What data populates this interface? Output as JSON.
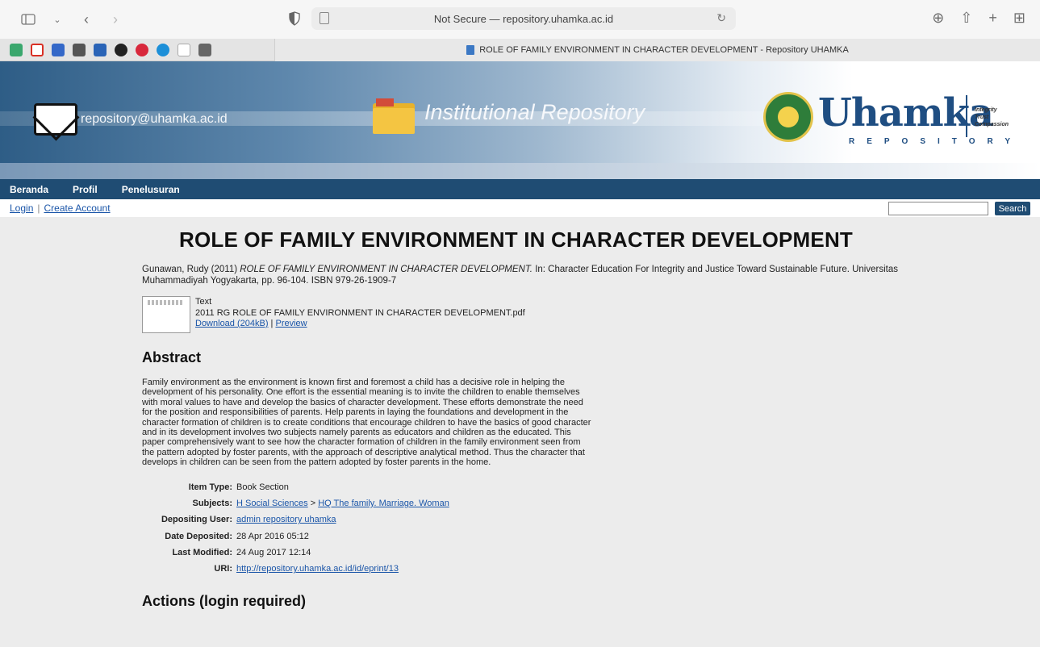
{
  "browser": {
    "address": "Not Secure — repository.uhamka.ac.id",
    "tab_title": "ROLE OF FAMILY ENVIRONMENT IN CHARACTER DEVELOPMENT - Repository UHAMKA"
  },
  "header": {
    "email": "repository@uhamka.ac.id",
    "repo_title": "Institutional Repository",
    "brand": "Uhamka",
    "brand_sub": "REPOSITORY",
    "tagline": [
      "Integrity",
      "Trust",
      "Compassion"
    ]
  },
  "nav": [
    "Beranda",
    "Profil",
    "Penelusuran"
  ],
  "account": {
    "login": "Login",
    "separator": "|",
    "create": "Create Account",
    "search_button": "Search"
  },
  "item": {
    "title": "ROLE OF FAMILY ENVIRONMENT IN CHARACTER DEVELOPMENT",
    "citation_prefix": "Gunawan, Rudy (2011) ",
    "citation_title": "ROLE OF FAMILY ENVIRONMENT IN CHARACTER DEVELOPMENT.",
    "citation_suffix": " In: Character Education For Integrity and Justice Toward Sustainable Future. Universitas Muhammadiyah Yogyakarta, pp. 96-104. ISBN 979-26-1909-7",
    "file_type": "Text",
    "file_name": "2011 RG ROLE OF FAMILY ENVIRONMENT IN CHARACTER DEVELOPMENT.pdf",
    "download_label": "Download (204kB)",
    "link_sep": " | ",
    "preview_label": "Preview",
    "abstract_heading": "Abstract",
    "abstract": "Family environment as the environment is known first and foremost a child has a decisive role in helping the development of his personality. One effort is the essential meaning is to invite the children to enable themselves with moral values to have and develop the basics of character development. These efforts demonstrate the need for the position and responsibilities of parents. Help parents in laying the foundations and development in the character formation of children is to create conditions that encourage children to have the basics of good character and in its development involves two subjects namely parents as educators and children as the educated. This paper comprehensively want to see how the character formation of children in the family environment seen from the pattern adopted by foster parents, with the approach of descriptive analytical method. Thus the character that develops in children can be seen from the pattern adopted by foster parents in the home.",
    "meta": {
      "item_type_label": "Item Type:",
      "item_type": "Book Section",
      "subjects_label": "Subjects:",
      "subject_1": "H Social Sciences",
      "subject_sep": " > ",
      "subject_2": "HQ The family. Marriage. Woman",
      "depositor_label": "Depositing User:",
      "depositor": "admin repository uhamka",
      "deposited_label": "Date Deposited:",
      "deposited": "28 Apr 2016 05:12",
      "modified_label": "Last Modified:",
      "modified": "24 Aug 2017 12:14",
      "uri_label": "URI:",
      "uri": "http://repository.uhamka.ac.id/id/eprint/13"
    },
    "actions_heading": "Actions (login required)"
  }
}
